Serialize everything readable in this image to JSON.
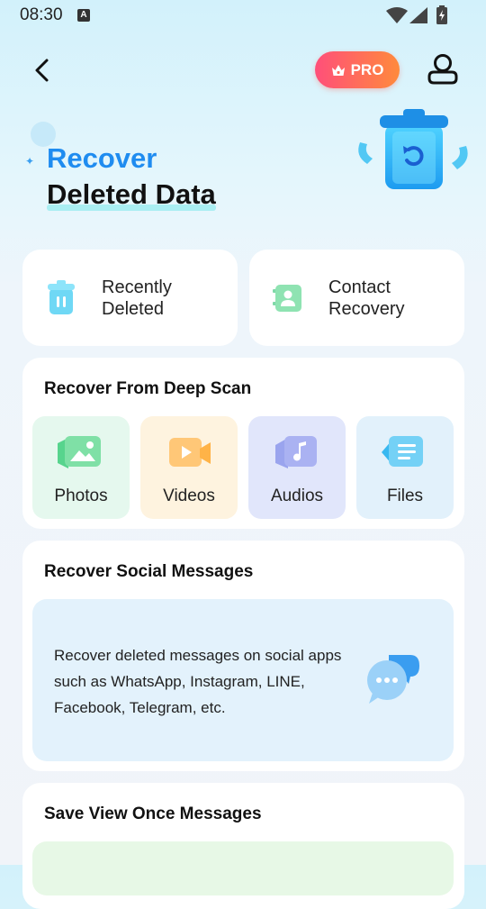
{
  "status_bar": {
    "time": "08:30",
    "notification_letter": "A"
  },
  "header": {
    "pro_label": "PRO"
  },
  "hero": {
    "line1": "Recover",
    "line2": "Deleted Data"
  },
  "quick_actions": [
    {
      "label_line1": "Recently",
      "label_line2": "Deleted"
    },
    {
      "label_line1": "Contact",
      "label_line2": "Recovery"
    }
  ],
  "deep_scan": {
    "title": "Recover From Deep Scan",
    "items": [
      {
        "label": "Photos",
        "color": "#e5f8ee"
      },
      {
        "label": "Videos",
        "color": "#fef3df"
      },
      {
        "label": "Audios",
        "color": "#e1e6fb"
      },
      {
        "label": "Files",
        "color": "#e2f1fb"
      }
    ]
  },
  "social": {
    "title": "Recover Social Messages",
    "description": "Recover deleted messages on social apps such as WhatsApp, Instagram, LINE, Facebook, Telegram, etc."
  },
  "view_once": {
    "title": "Save View Once Messages"
  },
  "colors": {
    "accent_blue": "#1f8cf0",
    "pro_gradient_start": "#ff4f7a",
    "pro_gradient_end": "#ff8a3c"
  }
}
